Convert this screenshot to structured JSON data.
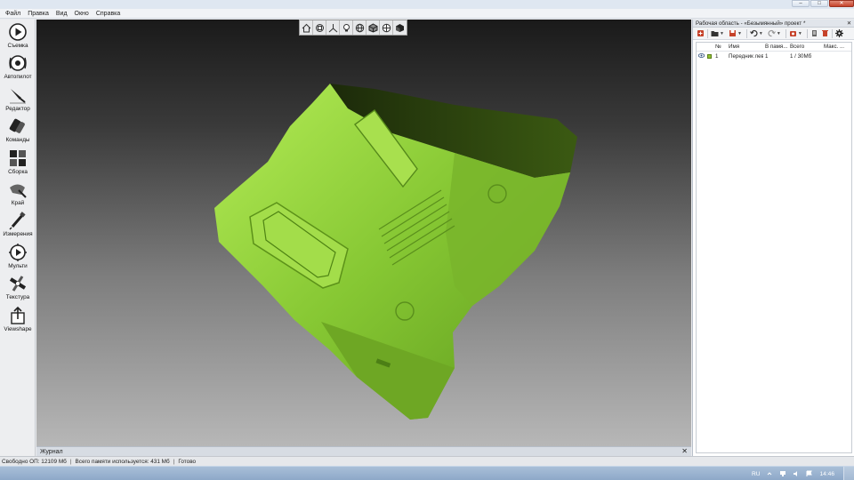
{
  "window": {
    "min_label": "–",
    "max_label": "□",
    "close_label": "✕"
  },
  "menu": [
    "Файл",
    "Правка",
    "Вид",
    "Окно",
    "Справка"
  ],
  "sidebar": {
    "tools": [
      {
        "label": "Съемка",
        "icon": "play-icon"
      },
      {
        "label": "Автопилот",
        "icon": "autopilot-icon"
      },
      {
        "label": "Редактор",
        "icon": "editor-knife-icon"
      },
      {
        "label": "Команды",
        "icon": "commands-icon"
      },
      {
        "label": "Сборка",
        "icon": "assembly-icon"
      },
      {
        "label": "Край",
        "icon": "edge-icon"
      },
      {
        "label": "Измерения",
        "icon": "measure-icon"
      },
      {
        "label": "Мульти",
        "icon": "multi-icon"
      },
      {
        "label": "Текстура",
        "icon": "texture-icon"
      },
      {
        "label": "Viewshape",
        "icon": "share-icon"
      }
    ]
  },
  "view_toolbar": {
    "buttons": [
      "home-view-icon",
      "grid-box-icon",
      "axes-icon",
      "light-bulb-icon",
      "wire-sphere-icon",
      "cube-shaded-icon",
      "globe-icon",
      "cube-solid-icon"
    ]
  },
  "journal": {
    "label": "Журнал",
    "close": "✕"
  },
  "right_panel": {
    "title": "Рабочая область - «Безымянный» проект *",
    "close": "✕",
    "columns": {
      "num": "№",
      "name": "Имя",
      "mem": "В памя...",
      "total": "Всего",
      "max": "Макс. ..."
    },
    "rows": [
      {
        "num": "1",
        "name": "Передник лев",
        "mem": "1",
        "total": "1 / 30Мб",
        "max": "",
        "color": "#8fc431"
      }
    ]
  },
  "status": {
    "free_memory": "Свободно ОП: 12109 Мб",
    "total_memory": "Всего памяти используется: 431 Мб",
    "state": "Готово"
  },
  "taskbar": {
    "lang": "RU",
    "time": "14:46"
  },
  "colors": {
    "model_green": "#8fd13a",
    "accent_red": "#c6422a"
  }
}
